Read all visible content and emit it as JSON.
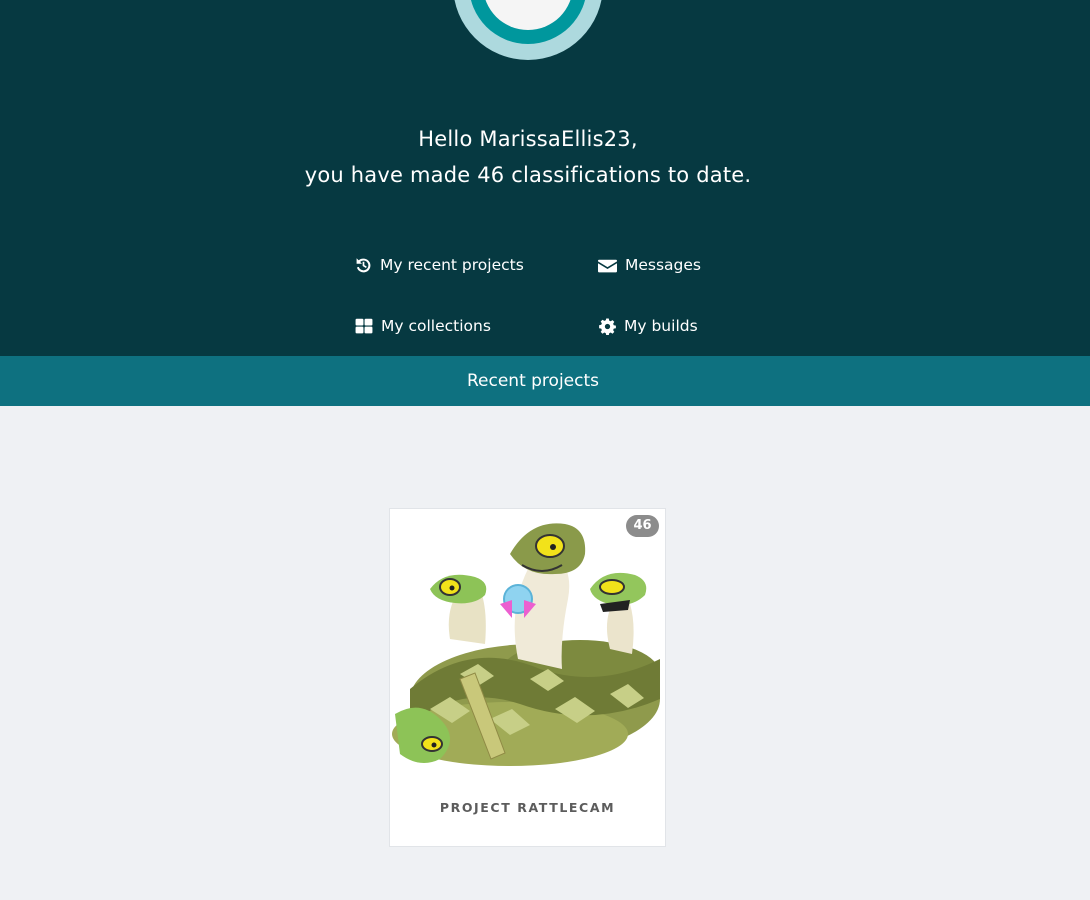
{
  "greeting": {
    "line1": "Hello MarissaEllis23,",
    "line2": "you have made 46 classifications to date."
  },
  "nav": {
    "recent_projects": {
      "label": "My recent projects",
      "icon": "history-icon"
    },
    "messages": {
      "label": "Messages",
      "icon": "envelope-icon"
    },
    "collections": {
      "label": "My collections",
      "icon": "grid-icon"
    },
    "builds": {
      "label": "My builds",
      "icon": "gear-icon"
    }
  },
  "section": {
    "title": "Recent projects"
  },
  "projects": [
    {
      "title": "Project RattleCam",
      "classifications": "46",
      "image": "rattlesnake-illustration"
    }
  ],
  "colors": {
    "hero_bg": "#063941",
    "section_bar": "#0e7180",
    "page_bg": "#eff1f4",
    "badge": "#8c8c8c"
  }
}
